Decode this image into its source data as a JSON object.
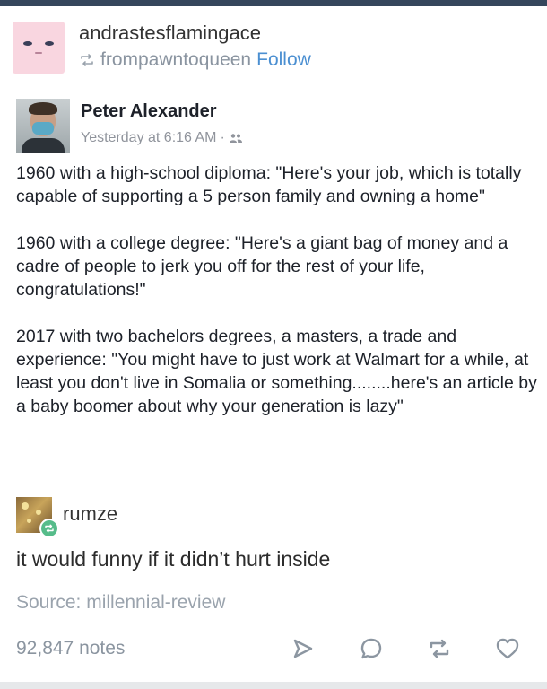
{
  "post": {
    "blog_name": "andrastesflamingace",
    "reblogged_from": "frompawntoqueen",
    "follow_label": "Follow"
  },
  "facebook_post": {
    "author": "Peter Alexander",
    "timestamp": "Yesterday at 6:16 AM",
    "separator": "·",
    "paragraphs": [
      "1960 with a high-school diploma: \"Here's your job, which is totally capable of supporting a 5 person family and owning a home\"",
      "1960 with a college degree: \"Here's a giant bag of money and a cadre of people to jerk you off for the rest of your life, congratulations!\"",
      "2017 with two bachelors degrees, a masters, a trade and experience: \"You might have to just work at Walmart for a while, at least you don't live in Somalia or something........here's an article by a baby boomer about why your generation is lazy\""
    ]
  },
  "reblog": {
    "username": "rumze",
    "comment": "it would funny if it didn’t hurt inside"
  },
  "source": {
    "label": "Source: millennial-review"
  },
  "footer": {
    "notes": "92,847 notes",
    "actions": [
      "share-icon",
      "reply-icon",
      "reblog-icon",
      "like-icon"
    ]
  },
  "colors": {
    "accent_link": "#4b8fd1",
    "muted_text": "#8b95a0",
    "reblog_green": "#56bc8a",
    "icon_gray": "#8c96a1"
  }
}
